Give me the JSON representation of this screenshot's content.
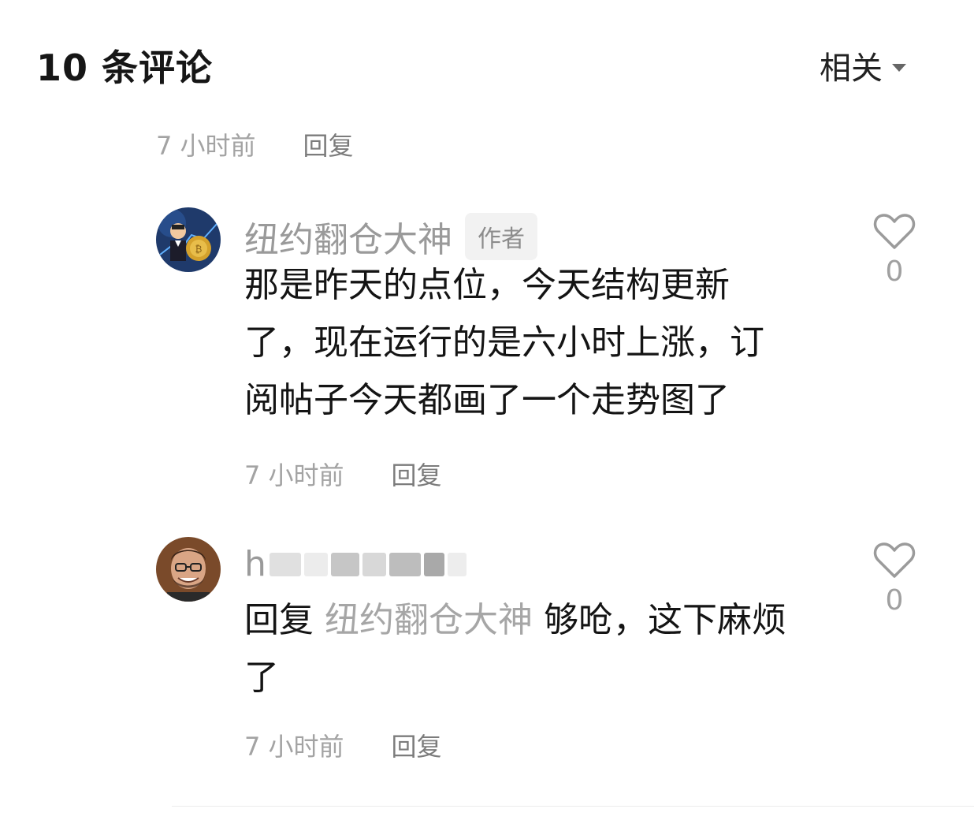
{
  "header": {
    "title": "10 条评论",
    "sort_label": "相关"
  },
  "prev_comment_meta": {
    "time": "7 小时前",
    "reply": "回复"
  },
  "comments": [
    {
      "username": "纽约翻仓大神",
      "badge": "作者",
      "text_lines": [
        "那是昨天的点位，今天结构更新",
        "了，现在运行的是六小时上涨，订",
        "阅帖子今天都画了一个走势图了"
      ],
      "time": "7 小时前",
      "reply": "回复",
      "likes": "0"
    },
    {
      "username": "h",
      "reply_prefix": "回复",
      "mention": "纽约翻仓大神",
      "text_line1": "够呛，这下麻烦",
      "text_line2": "了",
      "time": "7 小时前",
      "reply": "回复",
      "likes": "0"
    }
  ],
  "colors": {
    "muted": "#a3a3a3",
    "text": "#141414"
  },
  "icons": [
    "caret-down-icon",
    "heart-icon",
    "avatar-author",
    "avatar-user"
  ]
}
